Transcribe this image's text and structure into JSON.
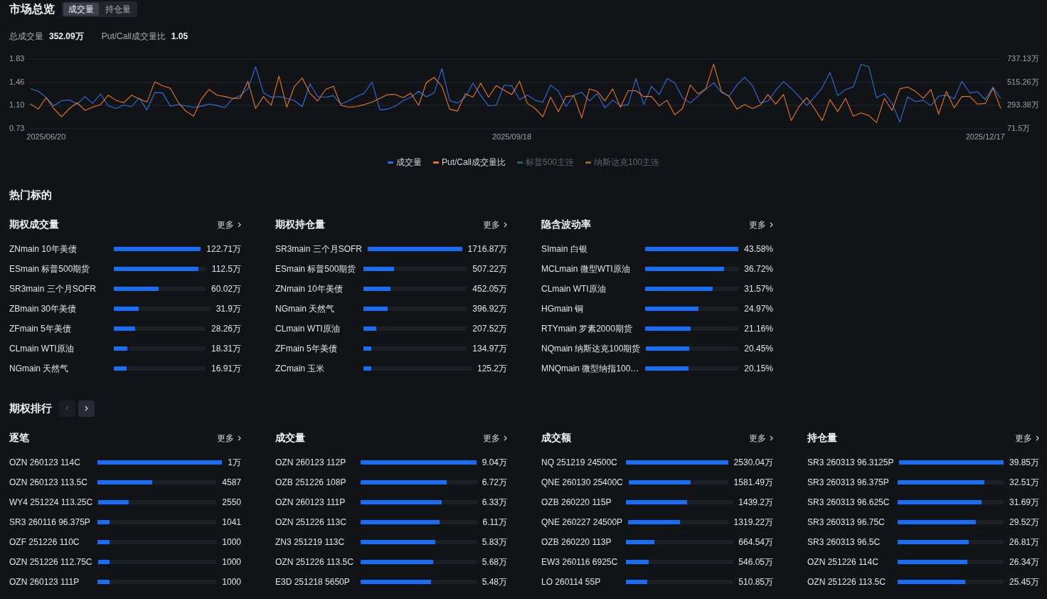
{
  "overview": {
    "title": "市场总览",
    "tabs": [
      {
        "label": "成交量",
        "selected": true
      },
      {
        "label": "持仓量",
        "selected": false
      }
    ],
    "stats": [
      {
        "label": "总成交量",
        "value": "352.09万"
      },
      {
        "label": "Put/Call成交量比",
        "value": "1.05"
      }
    ],
    "chart_data": {
      "type": "line",
      "categories": [
        null,
        null,
        "2025/06/20",
        null,
        null,
        null,
        null,
        null,
        null,
        null,
        null,
        null,
        null,
        null,
        null,
        null,
        null,
        null,
        null,
        null,
        null,
        null,
        null,
        null,
        null,
        null,
        null,
        null,
        null,
        null,
        null,
        null,
        null,
        null,
        null,
        null,
        null,
        null,
        null,
        null,
        null,
        null,
        null,
        null,
        null,
        null,
        null,
        null,
        null,
        null,
        null,
        null,
        null,
        null,
        null,
        null,
        null,
        null,
        null,
        null,
        null,
        null,
        "2025/09/18",
        null,
        null,
        null,
        null,
        null,
        null,
        null,
        null,
        null,
        null,
        null,
        null,
        null,
        null,
        null,
        null,
        null,
        null,
        null,
        null,
        null,
        null,
        null,
        null,
        null,
        null,
        null,
        null,
        null,
        null,
        null,
        null,
        null,
        null,
        null,
        null,
        null,
        null,
        null,
        null,
        null,
        null,
        null,
        null,
        null,
        null,
        null,
        null,
        null,
        null,
        null,
        null,
        null,
        null,
        null,
        null,
        null,
        null,
        null,
        null,
        "2025/12/17",
        null,
        null
      ],
      "ylim": [
        0.73,
        1.83
      ],
      "yticks": [
        {
          "value": 0.73,
          "label": "0.73"
        },
        {
          "value": 1.1,
          "label": "1.10"
        },
        {
          "value": 1.46,
          "label": "1.46"
        },
        {
          "value": 1.83,
          "label": "1.83"
        }
      ],
      "y2lim": [
        71.5,
        737.13
      ],
      "y2ticks": [
        {
          "value": 71.5,
          "label": "71.5万"
        },
        {
          "value": 293.38,
          "label": "293.38万"
        },
        {
          "value": 515.26,
          "label": "515.26万"
        },
        {
          "value": 737.13,
          "label": "737.13万"
        }
      ],
      "series": [
        {
          "name": "成交量",
          "color": "#2f6fe0",
          "axis": "y2",
          "values": [
            453,
            430,
            372,
            291,
            340,
            346,
            307,
            379,
            314,
            404,
            291,
            265,
            298,
            282,
            366,
            252,
            417,
            414,
            288,
            301,
            291,
            275,
            288,
            307,
            295,
            272,
            356,
            388,
            453,
            663,
            414,
            372,
            379,
            362,
            340,
            282,
            501,
            379,
            372,
            388,
            307,
            340,
            379,
            411,
            517,
            252,
            259,
            288,
            340,
            372,
            430,
            375,
            414,
            647,
            340,
            317,
            372,
            508,
            388,
            291,
            298,
            488,
            482,
            349,
            392,
            344,
            325,
            490,
            430,
            284,
            392,
            420,
            338,
            407,
            271,
            344,
            293,
            300,
            550,
            303,
            477,
            398,
            550,
            509,
            366,
            319,
            382,
            449,
            509,
            420,
            382,
            490,
            563,
            484,
            319,
            335,
            439,
            522,
            458,
            382,
            293,
            373,
            465,
            610,
            388,
            446,
            471,
            686,
            664,
            366,
            407,
            316,
            135,
            376,
            331,
            344,
            293,
            382,
            392,
            357,
            525,
            414,
            426,
            350,
            471,
            360
          ]
        },
        {
          "name": "Put/Call成交量比",
          "color": "#e5772a",
          "values": [
            1.12,
            1.04,
            1.22,
            1.05,
            0.92,
            1.05,
            1.14,
            1.02,
            1.07,
            1.11,
            1.26,
            1.18,
            1.14,
            1.26,
            1.2,
            1.15,
            1.47,
            1.41,
            1.37,
            1.15,
            1.01,
            0.93,
            1.2,
            1.35,
            1.26,
            1.24,
            1.21,
            1.21,
            1.48,
            1.05,
            1.24,
            1.1,
            1.56,
            1.07,
            1.4,
            1.53,
            1.29,
            1.17,
            1.35,
            1.4,
            1.1,
            1.07,
            1.08,
            1.11,
            1.15,
            1.21,
            1.27,
            1.27,
            1.22,
            1.29,
            1.1,
            1.46,
            1.54,
            1.4,
            1.04,
            1.01,
            1.28,
            1.23,
            1.45,
            1.23,
            1.41,
            1.34,
            1.27,
            1.48,
            1.13,
            1.05,
            0.92,
            1.23,
            1.0,
            1.24,
            1.25,
            0.9,
            1.36,
            1.32,
            1.17,
            1.36,
            1.07,
            1.33,
            1.33,
            1.24,
            1.24,
            1.09,
            1.18,
            0.95,
            1.05,
            1.42,
            1.28,
            1.36,
            1.75,
            1.32,
            1.24,
            1.04,
            1.11,
            1.05,
            1.1,
            1.27,
            1.12,
            1.27,
            0.86,
            1.08,
            1.22,
            1.05,
            0.86,
            1.19,
            1.0,
            1.21,
            0.93,
            0.98,
            0.94,
            0.83,
            1.21,
            1.02,
            1.36,
            1.39,
            1.32,
            1.21,
            1.35,
            0.96,
            1.32,
            1.06,
            1.24,
            1.24,
            1.12,
            1.13,
            1.37,
            1.05
          ]
        },
        {
          "name": "标普500主连",
          "color": "#2e5f5c",
          "values": [
            null,
            null,
            null,
            null,
            null,
            null,
            null,
            null,
            null,
            null,
            null,
            null,
            null,
            null,
            null,
            null,
            null,
            null,
            null,
            null,
            null,
            null,
            null,
            null,
            null,
            null,
            null,
            null,
            null,
            null,
            null,
            null,
            null,
            null,
            null,
            null,
            null,
            null,
            null,
            null,
            null,
            null,
            null,
            null,
            null,
            null,
            null,
            null,
            null,
            null,
            null,
            null,
            null,
            null,
            null,
            null,
            null,
            null,
            null,
            null,
            null,
            null,
            null,
            null,
            null,
            null,
            null,
            null,
            null,
            null,
            null,
            null,
            null,
            null,
            null,
            null,
            null,
            null,
            null,
            null,
            null,
            null,
            null,
            null,
            null,
            null,
            null,
            null,
            null,
            null,
            null,
            null,
            null,
            null,
            null,
            null,
            null,
            null,
            null,
            null,
            null,
            null,
            null,
            null,
            null,
            null,
            null,
            null,
            null,
            null,
            null,
            null,
            null,
            null,
            null,
            null,
            null,
            null,
            null,
            null,
            null,
            null,
            null,
            null,
            null,
            null
          ]
        },
        {
          "name": "纳斯达克100主连",
          "color": "#8c6a2c",
          "values": [
            null,
            null,
            null,
            null,
            null,
            null,
            null,
            null,
            null,
            null,
            null,
            null,
            null,
            null,
            null,
            null,
            null,
            null,
            null,
            null,
            null,
            null,
            null,
            null,
            null,
            null,
            null,
            null,
            null,
            null,
            null,
            null,
            null,
            null,
            null,
            null,
            null,
            null,
            null,
            null,
            null,
            null,
            null,
            null,
            null,
            null,
            null,
            null,
            null,
            null,
            null,
            null,
            null,
            null,
            null,
            null,
            null,
            null,
            null,
            null,
            null,
            null,
            null,
            null,
            null,
            null,
            null,
            null,
            null,
            null,
            null,
            null,
            null,
            null,
            null,
            null,
            null,
            null,
            null,
            null,
            null,
            null,
            null,
            null,
            null,
            null,
            null,
            null,
            null,
            null,
            null,
            null,
            null,
            null,
            null,
            null,
            null,
            null,
            null,
            null,
            null,
            null,
            null,
            null,
            null,
            null,
            null,
            null,
            null,
            null,
            null,
            null,
            null,
            null,
            null,
            null,
            null,
            null,
            null,
            null,
            null,
            null,
            null,
            null,
            null,
            null
          ]
        }
      ]
    }
  },
  "hot": {
    "title": "热门标的",
    "cards": [
      {
        "title": "期权成交量",
        "more_link": "更多",
        "rows": [
          {
            "name": "ZNmain 10年美债",
            "level": 1,
            "value": "122.71万"
          },
          {
            "name": "ESmain 标普500期货",
            "level": 0.917,
            "value": "112.5万"
          },
          {
            "name": "SR3main 三个月SOFR",
            "level": 0.489,
            "value": "60.02万"
          },
          {
            "name": "ZBmain 30年美债",
            "level": 0.26,
            "value": "31.9万"
          },
          {
            "name": "ZFmain 5年美债",
            "level": 0.23,
            "value": "28.26万"
          },
          {
            "name": "CLmain WTI原油",
            "level": 0.149,
            "value": "18.31万"
          },
          {
            "name": "NGmain 天然气",
            "level": 0.138,
            "value": "16.91万"
          }
        ]
      },
      {
        "title": "期权持仓量",
        "more_link": "更多",
        "rows": [
          {
            "name": "SR3main 三个月SOFR",
            "level": 1,
            "value": "1716.87万"
          },
          {
            "name": "ESmain 标普500期货",
            "level": 0.295,
            "value": "507.22万"
          },
          {
            "name": "ZNmain 10年美债",
            "level": 0.263,
            "value": "452.05万"
          },
          {
            "name": "NGmain 天然气",
            "level": 0.231,
            "value": "396.92万"
          },
          {
            "name": "CLmain WTI原油",
            "level": 0.121,
            "value": "207.52万"
          },
          {
            "name": "ZFmain 5年美债",
            "level": 0.079,
            "value": "134.97万"
          },
          {
            "name": "ZCmain 玉米",
            "level": 0.073,
            "value": "125.2万"
          }
        ]
      },
      {
        "title": "隐含波动率",
        "more_link": "更多",
        "rows": [
          {
            "name": "SImain 白银",
            "level": 1,
            "value": "43.58%"
          },
          {
            "name": "MCLmain 微型WTI原油",
            "level": 0.843,
            "value": "36.72%"
          },
          {
            "name": "CLmain WTI原油",
            "level": 0.724,
            "value": "31.57%"
          },
          {
            "name": "HGmain 铜",
            "level": 0.573,
            "value": "24.97%"
          },
          {
            "name": "RTYmain 罗素2000期货",
            "level": 0.486,
            "value": "21.16%"
          },
          {
            "name": "NQmain 纳斯达克100期货",
            "level": 0.469,
            "value": "20.45%"
          },
          {
            "name": "MNQmain 微型纳指100…",
            "level": 0.462,
            "value": "20.15%"
          }
        ]
      }
    ]
  },
  "ranking": {
    "title": "期权排行",
    "nav": [
      {
        "kind": "prev",
        "disabled": true
      },
      {
        "kind": "next",
        "disabled": false
      }
    ],
    "cards": [
      {
        "title": "逐笔",
        "more_link": "更多",
        "rows": [
          {
            "name": "OZN 260123 114C",
            "level": 1,
            "value": "1万"
          },
          {
            "name": "OZN 260123 113.5C",
            "level": 0.459,
            "value": "4587"
          },
          {
            "name": "WY4 251224 113.25C",
            "level": 0.255,
            "value": "2550"
          },
          {
            "name": "SR3 260116 96.375P",
            "level": 0.104,
            "value": "1041"
          },
          {
            "name": "OZF 251226 110C",
            "level": 0.1,
            "value": "1000"
          },
          {
            "name": "OZN 251226 112.75C",
            "level": 0.1,
            "value": "1000"
          },
          {
            "name": "OZN 260123 111P",
            "level": 0.1,
            "value": "1000"
          }
        ]
      },
      {
        "title": "成交量",
        "more_link": "更多",
        "rows": [
          {
            "name": "OZN 260123 112P",
            "level": 1,
            "value": "9.04万"
          },
          {
            "name": "OZB 251226 108P",
            "level": 0.743,
            "value": "6.72万"
          },
          {
            "name": "OZN 260123 111P",
            "level": 0.7,
            "value": "6.33万"
          },
          {
            "name": "OZN 251226 113C",
            "level": 0.676,
            "value": "6.11万"
          },
          {
            "name": "ZN3 251219 113C",
            "level": 0.645,
            "value": "5.83万"
          },
          {
            "name": "OZN 251226 113.5C",
            "level": 0.628,
            "value": "5.68万"
          },
          {
            "name": "E3D 251218 5650P",
            "level": 0.606,
            "value": "5.48万"
          }
        ]
      },
      {
        "title": "成交额",
        "more_link": "更多",
        "rows": [
          {
            "name": "NQ 251219 24500C",
            "level": 1,
            "value": "2530.04万"
          },
          {
            "name": "QNE 260130 25400C",
            "level": 0.625,
            "value": "1581.49万"
          },
          {
            "name": "OZB 260220 115P",
            "level": 0.569,
            "value": "1439.2万"
          },
          {
            "name": "QNE 260227 24500P",
            "level": 0.521,
            "value": "1319.22万"
          },
          {
            "name": "OZB 260220 113P",
            "level": 0.263,
            "value": "664.54万"
          },
          {
            "name": "EW3 260116 6925C",
            "level": 0.216,
            "value": "546.05万"
          },
          {
            "name": "LO 260114 55P",
            "level": 0.202,
            "value": "510.85万"
          }
        ]
      },
      {
        "title": "持仓量",
        "more_link": "更多",
        "rows": [
          {
            "name": "SR3 260313 96.3125P",
            "level": 1,
            "value": "39.85万"
          },
          {
            "name": "SR3 260313 96.375P",
            "level": 0.816,
            "value": "32.51万"
          },
          {
            "name": "SR3 260313 96.625C",
            "level": 0.795,
            "value": "31.69万"
          },
          {
            "name": "SR3 260313 96.75C",
            "level": 0.741,
            "value": "29.52万"
          },
          {
            "name": "SR3 260313 96.5C",
            "level": 0.673,
            "value": "26.81万"
          },
          {
            "name": "OZN 251226 114C",
            "level": 0.661,
            "value": "26.34万"
          },
          {
            "name": "OZN 251226 113.5C",
            "level": 0.639,
            "value": "25.45万"
          }
        ]
      }
    ]
  }
}
